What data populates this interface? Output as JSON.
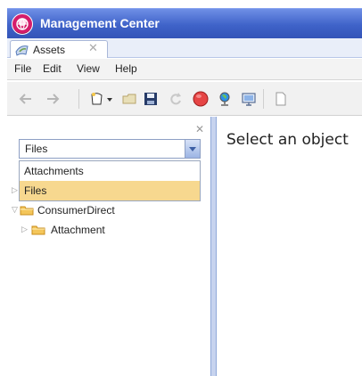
{
  "window": {
    "title": "Management Center",
    "tab_label": "Assets",
    "tab_close": "✕"
  },
  "menu": [
    "File",
    "Edit",
    "View",
    "Help"
  ],
  "toolbar": {
    "icons": [
      "back-arrow-icon",
      "forward-arrow-icon",
      "new-item-icon",
      "open-folder-icon",
      "save-icon",
      "refresh-icon",
      "stop-icon",
      "globe-icon",
      "display-icon"
    ]
  },
  "left_panel": {
    "close_symbol": "✕",
    "combo_value": "Files",
    "dropdown_options": [
      {
        "label": "Attachments"
      },
      {
        "label": "Files",
        "selected": true
      }
    ],
    "tree": [
      {
        "label": "ConsumerDirect",
        "expanded": true
      },
      {
        "label": "Attachment",
        "expanded": false
      }
    ]
  },
  "main": {
    "message": "Select an object"
  },
  "colors": {
    "title_bar": "#3f63c9",
    "selected_option": "#f7d88f",
    "folder": "#f2b740"
  }
}
